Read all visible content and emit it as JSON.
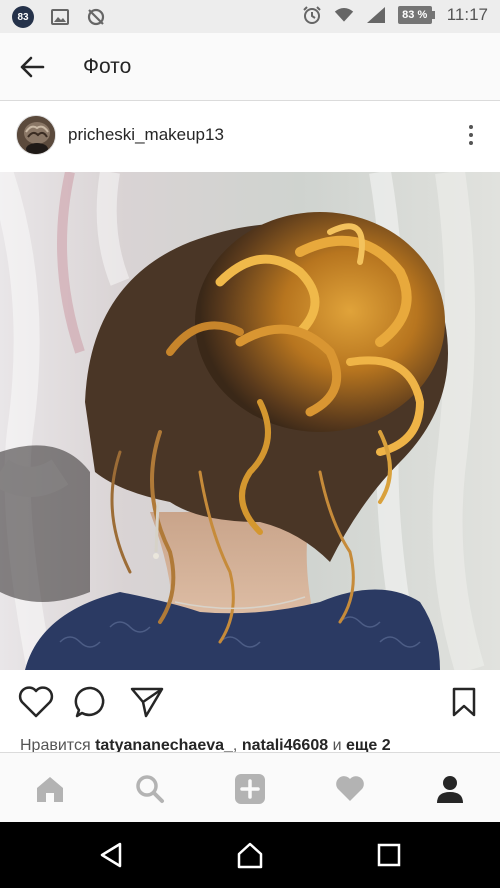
{
  "status_bar": {
    "badge": "83",
    "icons": [
      "notification-badge",
      "image-icon",
      "no-sync-icon",
      "alarm-icon",
      "wifi-icon",
      "signal-icon"
    ],
    "battery": "83 %",
    "time": "11:17"
  },
  "header": {
    "back_icon": "arrow-left-icon",
    "title": "Фото"
  },
  "post": {
    "username": "pricheski_makeup13",
    "more_icon": "vertical-dots-icon",
    "photo_alt": "Hairstyle photo"
  },
  "actions": {
    "icons": [
      "heart-icon",
      "comment-icon",
      "share-icon",
      "bookmark-icon"
    ]
  },
  "likes": {
    "prefix": "Нравится",
    "user1": "tatyananechaeva_",
    "separator": ",",
    "user2": "natali46608",
    "conj": "и",
    "more": "еще 2"
  },
  "bottom_nav": {
    "icons": [
      "home-icon",
      "search-icon",
      "add-icon",
      "activity-heart-icon",
      "profile-icon"
    ],
    "active": "profile-icon"
  },
  "android_nav": {
    "icons": [
      "back-triangle-icon",
      "home-circle-icon",
      "recents-square-icon"
    ]
  },
  "colors": {
    "status_bar_bg": "#ededed",
    "header_bg": "#fafafa",
    "text": "#262626",
    "inactive_icon": "#b3b3b3",
    "android_nav_bg": "#000000"
  }
}
